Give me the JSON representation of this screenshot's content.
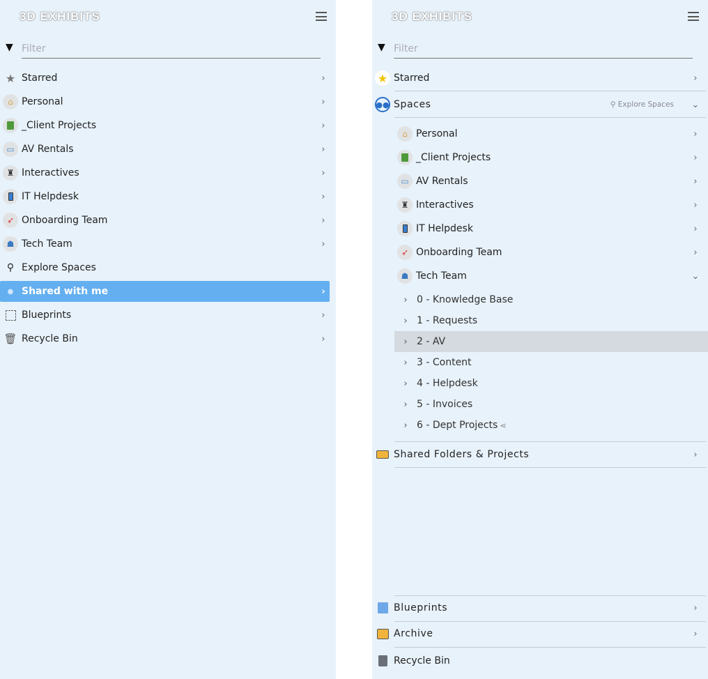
{
  "logo": "3D EXHIBITS",
  "filter_placeholder": "Filter",
  "left": {
    "items": [
      {
        "label": "Starred",
        "icon": "star-icon"
      },
      {
        "label": "Personal",
        "icon": "house-icon"
      },
      {
        "label": "_Client Projects",
        "icon": "book-icon"
      },
      {
        "label": "AV Rentals",
        "icon": "laptop-icon"
      },
      {
        "label": "Interactives",
        "icon": "joystick-icon"
      },
      {
        "label": "IT Helpdesk",
        "icon": "phone-icon"
      },
      {
        "label": "Onboarding Team",
        "icon": "rocket-icon"
      },
      {
        "label": "Tech Team",
        "icon": "robot-icon"
      },
      {
        "label": "Explore Spaces",
        "icon": "search-icon"
      },
      {
        "label": "Shared with me",
        "icon": "dot-icon"
      },
      {
        "label": "Blueprints",
        "icon": "blueprint-icon"
      },
      {
        "label": "Recycle Bin",
        "icon": "trash-icon"
      }
    ]
  },
  "right": {
    "starred": "Starred",
    "spaces": "Spaces",
    "explore": "Explore Spaces",
    "spaces_items": [
      "Personal",
      "_Client Projects",
      "AV Rentals",
      "Interactives",
      "IT Helpdesk",
      "Onboarding Team",
      "Tech Team"
    ],
    "tech_children": [
      "0 - Knowledge Base",
      "1 - Requests",
      "2 - AV",
      "3 - Content",
      "4 - Helpdesk",
      "5 - Invoices",
      "6 - Dept Projects"
    ],
    "shared": "Shared Folders & Projects",
    "blueprints": "Blueprints",
    "archive": "Archive",
    "recycle": "Recycle Bin"
  }
}
